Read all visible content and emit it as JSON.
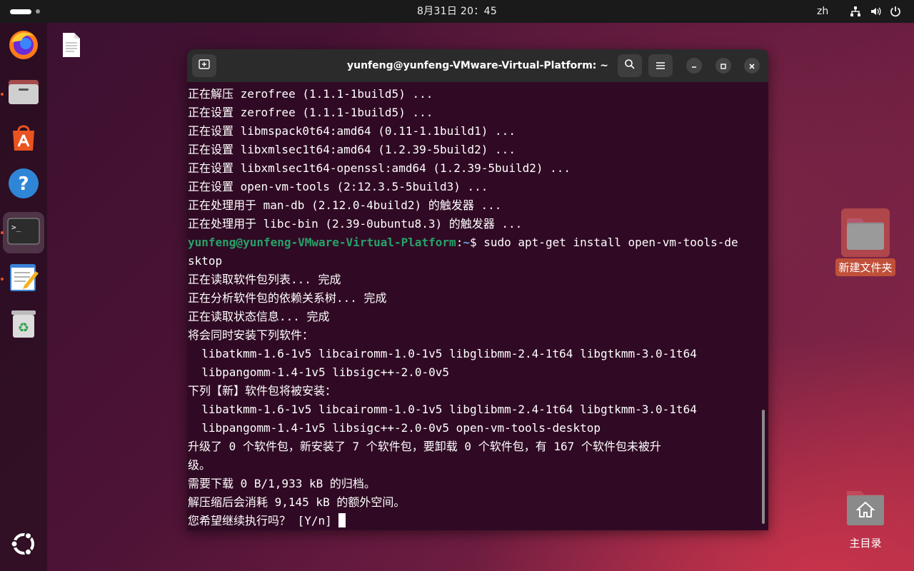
{
  "topbar": {
    "clock": "8月31日  20：45",
    "language": "zh",
    "icons": [
      "network-icon",
      "volume-icon",
      "power-icon"
    ]
  },
  "dock": {
    "items": [
      {
        "name": "firefox",
        "running": false
      },
      {
        "name": "files",
        "running": true
      },
      {
        "name": "app-center",
        "running": false
      },
      {
        "name": "help",
        "running": false
      },
      {
        "name": "terminal",
        "running": true,
        "active": true
      },
      {
        "name": "text-editor",
        "running": true
      },
      {
        "name": "trash",
        "running": false
      }
    ],
    "show_apps": "ubuntu-logo-icon"
  },
  "desktop": {
    "new_folder_label": "新建文件夹",
    "home_label": "主目录"
  },
  "terminal": {
    "title": "yunfeng@yunfeng-VMware-Virtual-Platform: ~",
    "prompt_user": "yunfeng@yunfeng-VMware-Virtual-Platform",
    "prompt_sep": ":",
    "prompt_path": "~",
    "prompt_symbol": "$",
    "command": " sudo apt-get install open-vm-tools-de",
    "lines_before": [
      "正在解压 zerofree (1.1.1-1build5) ...",
      "正在设置 zerofree (1.1.1-1build5) ...",
      "正在设置 libmspack0t64:amd64 (0.11-1.1build1) ...",
      "正在设置 libxmlsec1t64:amd64 (1.2.39-5build2) ...",
      "正在设置 libxmlsec1t64-openssl:amd64 (1.2.39-5build2) ...",
      "正在设置 open-vm-tools (2:12.3.5-5build3) ...",
      "正在处理用于 man-db (2.12.0-4build2) 的触发器 ...",
      "正在处理用于 libc-bin (2.39-0ubuntu8.3) 的触发器 ..."
    ],
    "lines_after": [
      "sktop",
      "正在读取软件包列表... 完成",
      "正在分析软件包的依赖关系树... 完成",
      "正在读取状态信息... 完成",
      "将会同时安装下列软件：",
      "  libatkmm-1.6-1v5 libcairomm-1.0-1v5 libglibmm-2.4-1t64 libgtkmm-3.0-1t64",
      "  libpangomm-1.4-1v5 libsigc++-2.0-0v5",
      "下列【新】软件包将被安装：",
      "  libatkmm-1.6-1v5 libcairomm-1.0-1v5 libglibmm-2.4-1t64 libgtkmm-3.0-1t64",
      "  libpangomm-1.4-1v5 libsigc++-2.0-0v5 open-vm-tools-desktop",
      "升级了 0 个软件包，新安装了 7 个软件包，要卸载 0 个软件包，有 167 个软件包未被升",
      "级。",
      "需要下载 0 B/1,933 kB 的归档。",
      "解压缩后会消耗 9,145 kB 的额外空间。"
    ],
    "final_prompt": "您希望继续执行吗？ [Y/n] "
  }
}
